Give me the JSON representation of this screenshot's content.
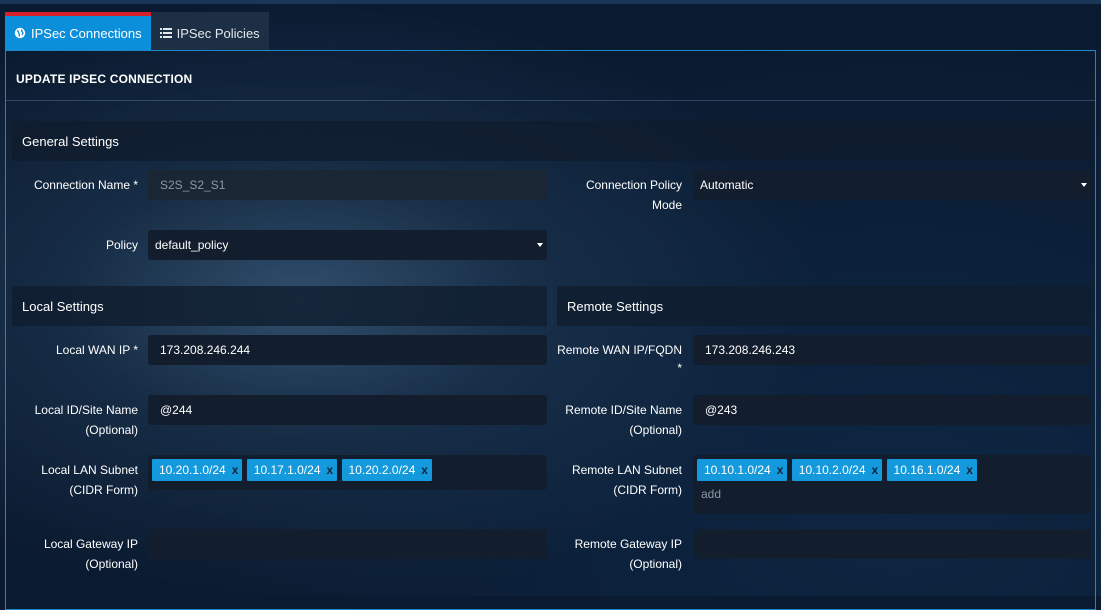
{
  "tabs": [
    {
      "label": "IPSec Connections",
      "icon": "globe-icon",
      "active": true
    },
    {
      "label": "IPSec Policies",
      "icon": "list-icon",
      "active": false
    }
  ],
  "panel": {
    "title": "UPDATE IPSEC CONNECTION"
  },
  "general": {
    "heading": "General Settings",
    "connection_name": {
      "label": "Connection Name *",
      "value": "S2S_S2_S1"
    },
    "connection_policy_mode": {
      "label_line1": "Connection Policy",
      "label_line2": "Mode",
      "value": "Automatic"
    },
    "policy": {
      "label": "Policy",
      "value": "default_policy"
    }
  },
  "local": {
    "heading": "Local Settings",
    "wan_ip": {
      "label": "Local WAN IP *",
      "value": "173.208.246.244"
    },
    "id_site_name": {
      "label_line1": "Local ID/Site Name",
      "label_line2": "(Optional)",
      "value": "@244"
    },
    "lan_subnet": {
      "label_line1": "Local LAN Subnet",
      "label_line2": "(CIDR Form)",
      "tags": [
        "10.20.1.0/24",
        "10.17.1.0/24",
        "10.20.2.0/24"
      ]
    },
    "gateway_ip": {
      "label_line1": "Local Gateway IP",
      "label_line2": "(Optional)",
      "value": ""
    }
  },
  "remote": {
    "heading": "Remote Settings",
    "wan_ip": {
      "label_line1": "Remote WAN IP/FQDN",
      "label_line2": "*",
      "value": "173.208.246.243"
    },
    "id_site_name": {
      "label_line1": "Remote ID/Site Name",
      "label_line2": "(Optional)",
      "value": "@243"
    },
    "lan_subnet": {
      "label_line1": "Remote LAN Subnet",
      "label_line2": "(CIDR Form)",
      "tags": [
        "10.10.1.0/24",
        "10.10.2.0/24",
        "10.16.1.0/24"
      ],
      "add_placeholder": "add"
    },
    "gateway_ip": {
      "label_line1": "Remote Gateway IP",
      "label_line2": "(Optional)",
      "value": ""
    }
  },
  "colors": {
    "accent": "#0c8fdb",
    "tab_marker": "#d8202a",
    "tag": "#1499dc"
  }
}
